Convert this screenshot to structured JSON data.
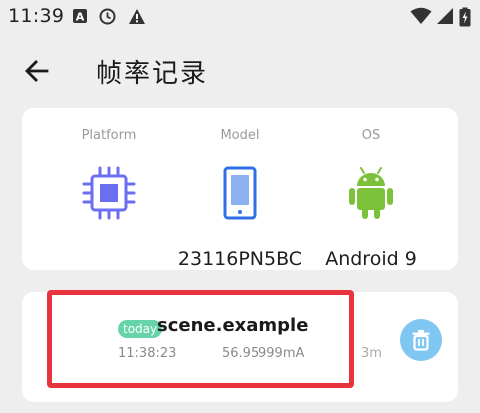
{
  "status_bar": {
    "time": "11:39",
    "left_icons": [
      "a-box-icon",
      "clock-icon",
      "warning-icon"
    ],
    "right_icons": [
      "wifi-icon",
      "signal-icon",
      "battery-charging-icon"
    ]
  },
  "header": {
    "title": "帧率记录",
    "back_icon": "arrow-left-icon"
  },
  "device": {
    "platform": {
      "label": "Platform",
      "value": "",
      "icon": "chip-icon",
      "color": "#6c6ef2"
    },
    "model": {
      "label": "Model",
      "value": "23116PN5BC",
      "icon": "phone-icon",
      "color": "#2f6fe6"
    },
    "os": {
      "label": "OS",
      "value": "Android 9",
      "icon": "android-icon",
      "color": "#7cc13a"
    }
  },
  "record": {
    "badge": "today",
    "app_name": "scene.example",
    "time": "11:38:23",
    "fps": "56.95",
    "current": "999mA",
    "duration": "3m",
    "delete_icon": "trash-icon"
  },
  "colors": {
    "badge": "#66d4a8",
    "delete_button": "#7fc6f2",
    "highlight": "#e8343e"
  }
}
